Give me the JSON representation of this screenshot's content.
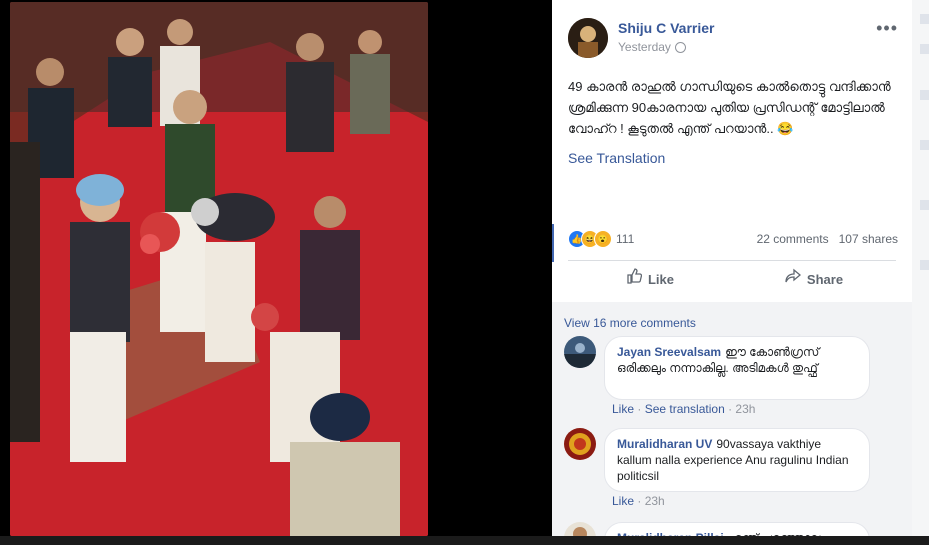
{
  "post": {
    "author": "Shiju C Varrier",
    "time": "Yesterday",
    "text": "49 കാരൻ രാഹുൽ ഗാന്ധിയുടെ കാൽതൊട്ടു വന്ദിക്കാൻ ശ്രമിക്കുന്ന 90കാരനായ പുതിയ പ്രസിഡന്റ് മോട്ടിലാൽ വോഹ്റ ! കൂടുതൽ എന്ത് പറയാൻ.. 😂",
    "see_translation": "See Translation",
    "reaction_count": "111",
    "comments_count": "22 comments",
    "shares_count": "107 shares",
    "like_label": "Like",
    "share_label": "Share"
  },
  "comments_section": {
    "view_more": "View 16 more comments",
    "items": [
      {
        "name": "Jayan Sreevalsam",
        "text": "ഈ കോൺഗ്രസ് ഒരിക്കലും നന്നാകില്ല. അടിമകൾ തുഫ്ഫ്",
        "like": "Like",
        "translate": "See translation",
        "time": "23h"
      },
      {
        "name": "Muralidharan UV",
        "text": "90vassaya vakthiye kallum nalla experience Anu ragulinu Indian politicsil",
        "like": "Like",
        "time": "23h"
      },
      {
        "name": "Muralidharan Pillai",
        "text": "എന്ത് പറഞ്ഞാലും"
      }
    ]
  },
  "icons": {
    "more": "more-options-icon",
    "privacy": "globe-icon",
    "like": "thumbs-up-icon",
    "share": "share-arrow-icon"
  },
  "colors": {
    "link_blue": "#385898",
    "background": "#000000",
    "comments_bg": "#f2f3f5"
  }
}
